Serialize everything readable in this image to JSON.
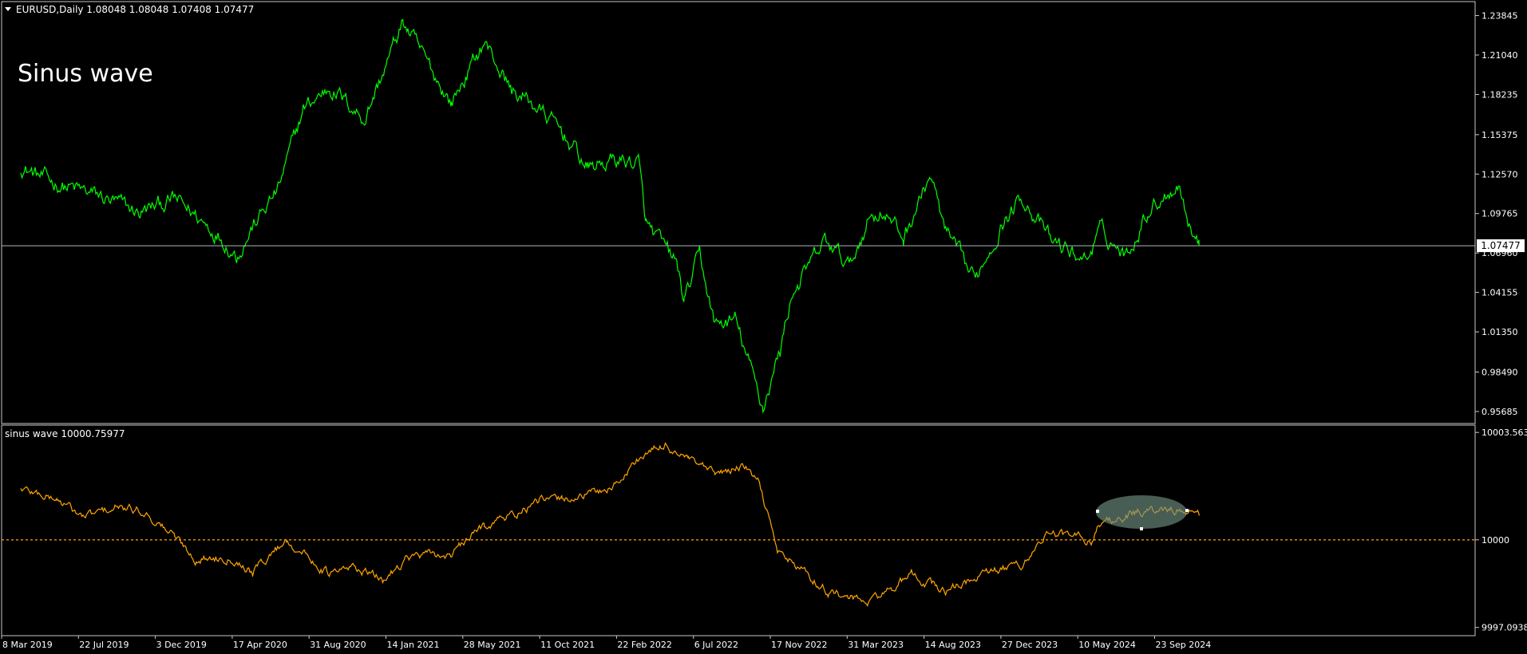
{
  "main_panel": {
    "header_label": "EURUSD,Daily  1.08048 1.08048 1.07408 1.07477",
    "annotation_text": "Sinus wave",
    "current_price_label": "1.07477",
    "line_color": "#00ff00"
  },
  "indicator_panel": {
    "header_label": "sinus wave 10000.75977",
    "line_color": "#ffa500"
  },
  "chart_data": [
    {
      "type": "line",
      "title": "EURUSD,Daily  1.08048 1.08048 1.07408 1.07477",
      "yticks": [
        "1.23845",
        "1.21040",
        "1.18235",
        "1.15375",
        "1.12570",
        "1.09765",
        "1.06960",
        "1.04155",
        "1.01350",
        "0.98490",
        "0.95685"
      ],
      "ylim": [
        0.95,
        1.245
      ],
      "current_price": 1.07477,
      "series": [
        {
          "x": [
            "2019-03-08",
            "2019-05-01",
            "2019-07-22",
            "2019-10-01",
            "2019-12-03",
            "2020-02-20",
            "2020-03-20",
            "2020-04-17",
            "2020-06-01",
            "2020-07-15",
            "2020-08-31",
            "2020-10-30",
            "2021-01-06",
            "2021-01-14",
            "2021-03-31",
            "2021-05-28",
            "2021-07-15",
            "2021-08-20",
            "2021-10-11",
            "2021-11-25",
            "2022-01-14",
            "2022-02-22",
            "2022-03-07",
            "2022-04-30",
            "2022-05-13",
            "2022-06-09",
            "2022-07-06",
            "2022-08-10",
            "2022-09-28",
            "2022-10-28",
            "2022-11-17",
            "2023-01-15",
            "2023-02-28",
            "2023-03-31",
            "2023-04-26",
            "2023-06-01",
            "2023-07-18",
            "2023-08-14",
            "2023-10-03",
            "2023-11-20",
            "2023-12-27",
            "2024-02-14",
            "2024-04-16",
            "2024-05-10",
            "2024-06-26",
            "2024-08-02",
            "2024-09-25",
            "2024-10-14",
            "2024-10-31"
          ],
          "y": [
            1.131,
            1.12,
            1.11,
            1.098,
            1.108,
            1.082,
            1.068,
            1.088,
            1.115,
            1.172,
            1.188,
            1.165,
            1.234,
            1.228,
            1.176,
            1.22,
            1.185,
            1.176,
            1.156,
            1.13,
            1.136,
            1.134,
            1.09,
            1.062,
            1.035,
            1.068,
            1.018,
            1.022,
            0.96,
            1.0,
            1.04,
            1.078,
            1.06,
            1.094,
            1.1,
            1.08,
            1.125,
            1.084,
            1.05,
            1.09,
            1.11,
            1.078,
            1.065,
            1.085,
            1.068,
            1.1,
            1.12,
            1.09,
            1.075
          ]
        }
      ]
    },
    {
      "type": "line",
      "title": "sinus wave 10000.75977",
      "yticks": [
        "10003.563",
        "10000",
        "9997.0938"
      ],
      "ylim": [
        9996.9,
        10003.7
      ],
      "reference_level": 10000,
      "xticks": [
        "8 Mar 2019",
        "22 Jul 2019",
        "3 Dec 2019",
        "17 Apr 2020",
        "31 Aug 2020",
        "14 Jan 2021",
        "28 May 2021",
        "11 Oct 2021",
        "22 Feb 2022",
        "6 Jul 2022",
        "17 Nov 2022",
        "31 Mar 2023",
        "14 Aug 2023",
        "27 Dec 2023",
        "10 May 2024",
        "23 Sep 2024"
      ],
      "series": [
        {
          "x": [
            "2019-03-08",
            "2019-05-10",
            "2019-06-25",
            "2019-08-20",
            "2019-10-10",
            "2019-12-03",
            "2020-01-10",
            "2020-03-10",
            "2020-04-17",
            "2020-06-15",
            "2020-08-31",
            "2020-10-15",
            "2020-12-01",
            "2021-01-14",
            "2021-04-01",
            "2021-05-28",
            "2021-07-20",
            "2021-09-01",
            "2021-10-11",
            "2021-12-10",
            "2022-01-14",
            "2022-02-22",
            "2022-04-10",
            "2022-05-20",
            "2022-07-06",
            "2022-08-25",
            "2022-09-20",
            "2022-10-25",
            "2022-11-17",
            "2023-01-20",
            "2023-03-31",
            "2023-06-15",
            "2023-08-14",
            "2023-10-20",
            "2023-12-27",
            "2024-02-10",
            "2024-04-25",
            "2024-05-10",
            "2024-07-15",
            "2024-09-23",
            "2024-10-31"
          ],
          "y": [
            10001.7,
            10001.35,
            10000.75,
            10001.05,
            10000.95,
            10000.1,
            9999.35,
            9999.45,
            9998.95,
            10000.0,
            9998.85,
            9999.1,
            9998.65,
            9999.45,
            9999.5,
            10000.5,
            10000.85,
            10001.25,
            10001.35,
            10001.55,
            10001.85,
            10002.7,
            10003.15,
            10002.65,
            10002.15,
            10002.45,
            10001.9,
            9999.65,
            9999.25,
            9998.3,
            9997.9,
            9998.8,
            9998.3,
            9998.85,
            9999.2,
            10000.25,
            10000.0,
            10000.55,
            10000.9,
            10001.0,
            10000.8
          ]
        }
      ]
    }
  ]
}
